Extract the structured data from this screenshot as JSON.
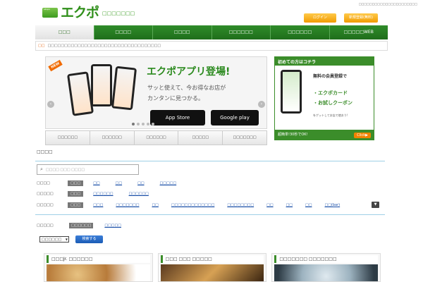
{
  "header": {
    "logo_card_text": "ekupo",
    "logo_text": "エクポ",
    "logo_sub": "□□□□□□□",
    "top_note": "□□□□□□□□□□□□□□□□□□□□□□",
    "login_label": "ログイン",
    "register_label": "新規登録(無料)"
  },
  "nav": [
    "□□□",
    "□□□□",
    "□□□□",
    "□□□□□□",
    "□□□□□□",
    "□□□□□WEB"
  ],
  "notice": {
    "badge": "□□",
    "text": "□□□□□□□□□□□□□□□□□□□□□□□□□□□□□□□□□□"
  },
  "hero": {
    "new_badge": "NEW",
    "title": "エクポアプリ登場!",
    "subtitle1": "サッと使えて、今お得なお店が",
    "subtitle2": "カンタンに見つかる。",
    "appstore_label": "App Store",
    "googleplay_label": "Google play",
    "arrow_left": "‹",
    "arrow_right": "›"
  },
  "side_ad": {
    "heading": "初めての方はコチラ",
    "line1": "無料の会員登録で",
    "line2": "・エクポカード",
    "line3": "・お試しクーポン",
    "line4": "をゲットしてお店で使おう!",
    "footer": "超簡単!30秒でOK!",
    "click_label": "Click▶"
  },
  "hero_tabs": [
    "□□□□□□",
    "□□□□□□",
    "□□□□□□",
    "□□□□□",
    "□□□□□□□"
  ],
  "search": {
    "title": "□□□□",
    "placeholder": "□□□□ □□□ □□□□",
    "icon": "search-icon"
  },
  "filters": [
    {
      "label": "□□□□",
      "options": [
        "□□□",
        "□□",
        "□□",
        "□□",
        "□□□□□"
      ]
    },
    {
      "label": "□□□□□",
      "options": [
        "□□□",
        "□□□□□□",
        "□□□□□□"
      ]
    },
    {
      "label": "□□□□□",
      "options": [
        "□□□",
        "□□□",
        "□□□□□□□",
        "□□",
        "□□□□□□□□□□□□□",
        "□□□□□□□□",
        "□□",
        "□□",
        "□□",
        "□□(bar)"
      ]
    }
  ],
  "sort": {
    "label": "□□□□□",
    "selected": "□□□□□□",
    "option": "□□□□□"
  },
  "select": {
    "value": "□□□□□□",
    "button": "検索する"
  },
  "cards": [
    {
      "title": "□□□Jr. □□□□□□"
    },
    {
      "title": "□□□ □□□ □□□□□"
    },
    {
      "title": "□□□□□□□ □□□□□□□"
    }
  ],
  "colors": {
    "brand_green": "#2f8c2a",
    "accent_orange": "#f29b00",
    "link_blue": "#1a4fa8"
  }
}
